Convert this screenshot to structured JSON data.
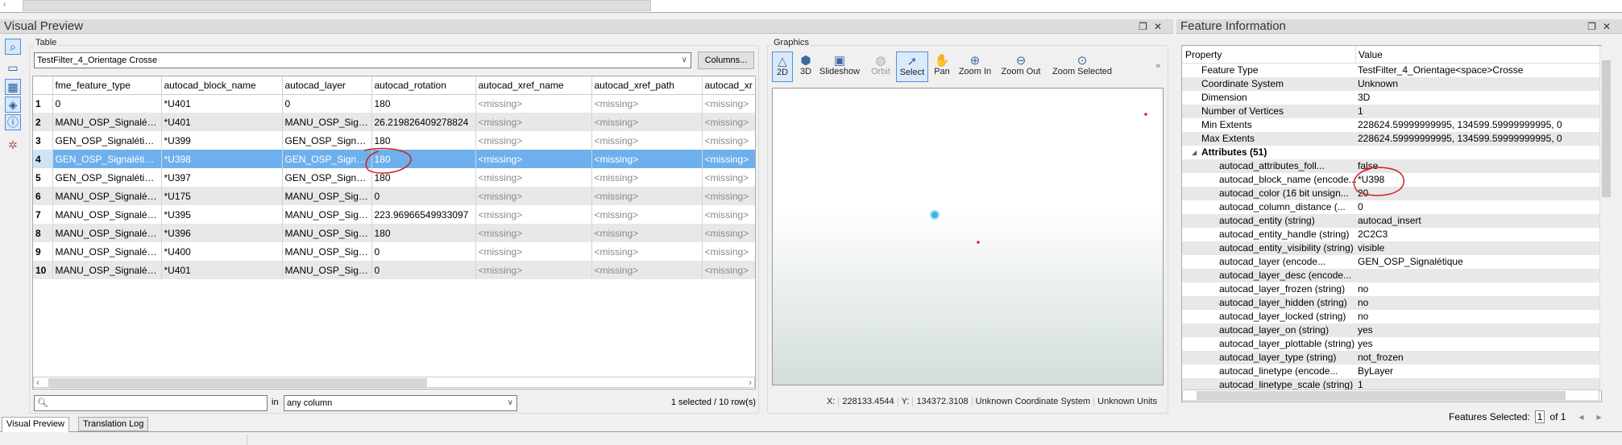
{
  "visual_preview": {
    "title": "Visual Preview",
    "table_label": "Table",
    "feature_type_select": "TestFilter_4_Orientage Crosse",
    "columns_button": "Columns...",
    "columns": [
      "fme_feature_type",
      "autocad_block_name",
      "autocad_layer",
      "autocad_rotation",
      "autocad_xref_name",
      "autocad_xref_path",
      "autocad_xr"
    ],
    "rows": [
      {
        "n": "1",
        "c": [
          "0",
          "*U401",
          "0",
          "180",
          "<missing>",
          "<missing>",
          "<missing>"
        ]
      },
      {
        "n": "2",
        "c": [
          "MANU_OSP_Signaléti...",
          "*U401",
          "MANU_OSP_Sign...",
          "26.219826409278824",
          "<missing>",
          "<missing>",
          "<missing>"
        ]
      },
      {
        "n": "3",
        "c": [
          "GEN_OSP_Signalétique",
          "*U399",
          "GEN_OSP_Signalé...",
          "180",
          "<missing>",
          "<missing>",
          "<missing>"
        ]
      },
      {
        "n": "4",
        "c": [
          "GEN_OSP_Signalétique",
          "*U398",
          "GEN_OSP_Signalé...",
          "180",
          "<missing>",
          "<missing>",
          "<missing>"
        ]
      },
      {
        "n": "5",
        "c": [
          "GEN_OSP_Signalétique",
          "*U397",
          "GEN_OSP_Signalé...",
          "180",
          "<missing>",
          "<missing>",
          "<missing>"
        ]
      },
      {
        "n": "6",
        "c": [
          "MANU_OSP_Signaléti...",
          "*U175",
          "MANU_OSP_Sign...",
          "0",
          "<missing>",
          "<missing>",
          "<missing>"
        ]
      },
      {
        "n": "7",
        "c": [
          "MANU_OSP_Signaléti...",
          "*U395",
          "MANU_OSP_Sign...",
          "223.96966549933097",
          "<missing>",
          "<missing>",
          "<missing>"
        ]
      },
      {
        "n": "8",
        "c": [
          "MANU_OSP_Signaléti...",
          "*U396",
          "MANU_OSP_Sign...",
          "180",
          "<missing>",
          "<missing>",
          "<missing>"
        ]
      },
      {
        "n": "9",
        "c": [
          "MANU_OSP_Signaléti...",
          "*U400",
          "MANU_OSP_Sign...",
          "0",
          "<missing>",
          "<missing>",
          "<missing>"
        ]
      },
      {
        "n": "10",
        "c": [
          "MANU_OSP_Signaléti...",
          "*U401",
          "MANU_OSP_Sign...",
          "0",
          "<missing>",
          "<missing>",
          "<missing>"
        ]
      }
    ],
    "selected_row": 4,
    "search_placeholder": "",
    "in_label": "in",
    "column_filter": "any column",
    "selection_status": "1 selected / 10 row(s)"
  },
  "graphics": {
    "label": "Graphics",
    "toolbar": [
      {
        "label": "2D",
        "icon": "2d-view-icon",
        "active": true
      },
      {
        "label": "3D",
        "icon": "3d-view-icon"
      },
      {
        "label": "Slideshow",
        "icon": "slideshow-icon"
      },
      {
        "label": "Orbit",
        "icon": "orbit-icon",
        "disabled": true
      },
      {
        "label": "Select",
        "icon": "select-icon",
        "active": true
      },
      {
        "label": "Pan",
        "icon": "hand-icon"
      },
      {
        "label": "Zoom In",
        "icon": "zoom-in-icon"
      },
      {
        "label": "Zoom Out",
        "icon": "zoom-out-icon"
      },
      {
        "label": "Zoom Selected",
        "icon": "zoom-selected-icon"
      }
    ],
    "more": "»",
    "x_label": "X:",
    "x_value": "228133.4544",
    "y_label": "Y:",
    "y_value": "134372.3108",
    "coord_system": "Unknown Coordinate System",
    "units": "Unknown Units",
    "point_color": "#e02020",
    "selected_color": "#3bb5e0"
  },
  "feature_info": {
    "title": "Feature Information",
    "header": {
      "property": "Property",
      "value": "Value"
    },
    "props": [
      [
        "Feature Type",
        "TestFilter_4_Orientage<space>Crosse"
      ],
      [
        "Coordinate System",
        "Unknown"
      ],
      [
        "Dimension",
        "3D"
      ],
      [
        "Number of Vertices",
        "1"
      ],
      [
        "Min Extents",
        "228624.59999999995, 134599.59999999995, 0"
      ],
      [
        "Max Extents",
        "228624.59999999995, 134599.59999999995, 0"
      ]
    ],
    "attributes_label": "Attributes (51)",
    "attributes": [
      [
        "autocad_attributes_foll...",
        "false"
      ],
      [
        "autocad_block_name (encode...",
        "*U398"
      ],
      [
        "autocad_color (16 bit unsign...",
        "20"
      ],
      [
        "autocad_column_distance (...",
        "0"
      ],
      [
        "autocad_entity (string)",
        "autocad_insert"
      ],
      [
        "autocad_entity_handle (string)",
        "2C2C3"
      ],
      [
        "autocad_entity_visibility (string)",
        "visible"
      ],
      [
        "autocad_layer (encode...",
        "GEN_OSP_Signalétique"
      ],
      [
        "autocad_layer_desc (encode...",
        ""
      ],
      [
        "autocad_layer_frozen (string)",
        "no"
      ],
      [
        "autocad_layer_hidden (string)",
        "no"
      ],
      [
        "autocad_layer_locked (string)",
        "no"
      ],
      [
        "autocad_layer_on (string)",
        "yes"
      ],
      [
        "autocad_layer_plottable (string)",
        "yes"
      ],
      [
        "autocad_layer_type (string)",
        "not_frozen"
      ],
      [
        "autocad_linetype (encode...",
        "ByLayer"
      ],
      [
        "autocad_linetype_scale (string)",
        "1"
      ]
    ],
    "features_selected_label": "Features Selected:",
    "features_selected_value": "1",
    "of_label": "of 1"
  },
  "tabs": [
    "Visual Preview",
    "Translation Log"
  ]
}
